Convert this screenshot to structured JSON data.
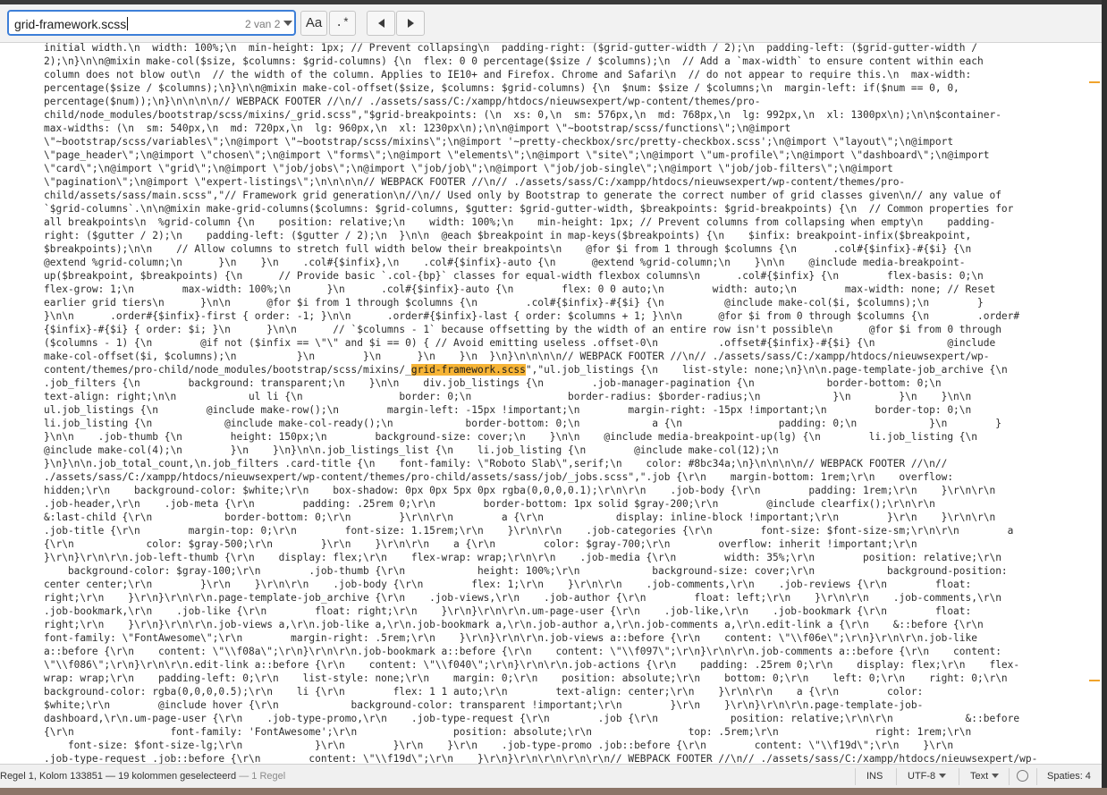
{
  "find": {
    "query": "grid-framework.scss",
    "match_count": "2 van 2",
    "case_label": "Aa",
    "regex_label": ".*"
  },
  "editor": {
    "lines": [
      "initial width.\\n  width: 100%;\\n  min-height: 1px; // Prevent collapsing\\n  padding-right: ($grid-gutter-width / 2);\\n  padding-left: ($grid-gutter-width /",
      "2);\\n}\\n\\n@mixin make-col($size, $columns: $grid-columns) {\\n  flex: 0 0 percentage($size / $columns);\\n  // Add a `max-width` to ensure content within each",
      "column does not blow out\\n  // the width of the column. Applies to IE10+ and Firefox. Chrome and Safari\\n  // do not appear to require this.\\n  max-width:",
      "percentage($size / $columns);\\n}\\n\\n@mixin make-col-offset($size, $columns: $grid-columns) {\\n  $num: $size / $columns;\\n  margin-left: if($num == 0, 0,",
      "percentage($num));\\n}\\n\\n\\n\\n// WEBPACK FOOTER //\\n// ./assets/sass/C:/xampp/htdocs/nieuwsexpert/wp-content/themes/pro-",
      "child/node_modules/bootstrap/scss/mixins/_grid.scss\",\"$grid-breakpoints: (\\n  xs: 0,\\n  sm: 576px,\\n  md: 768px,\\n  lg: 992px,\\n  xl: 1300px\\n);\\n\\n$container-",
      "max-widths: (\\n  sm: 540px,\\n  md: 720px,\\n  lg: 960px,\\n  xl: 1230px\\n);\\n\\n@import \\\"~bootstrap/scss/functions\\\";\\n@import",
      "\\\"~bootstrap/scss/variables\\\";\\n@import \\\"~bootstrap/scss/mixins\\\";\\n@import '~pretty-checkbox/src/pretty-checkbox.scss';\\n@import \\\"layout\\\";\\n@import",
      "\\\"page_header\\\";\\n@import \\\"chosen\\\";\\n@import \\\"forms\\\";\\n@import \\\"elements\\\";\\n@import \\\"site\\\";\\n@import \\\"um-profile\\\";\\n@import \\\"dashboard\\\";\\n@import",
      "\\\"card\\\";\\n@import \\\"grid\\\";\\n@import \\\"job/jobs\\\";\\n@import \\\"job/job\\\";\\n@import \\\"job/job-single\\\";\\n@import \\\"job/job-filters\\\";\\n@import",
      "\\\"pagination\\\";\\n@import \\\"expert-listings\\\";\\n\\n\\n\\n// WEBPACK FOOTER //\\n// ./assets/sass/C:/xampp/htdocs/nieuwsexpert/wp-content/themes/pro-",
      "child/assets/sass/main.scss\",\"// Framework grid generation\\n//\\n// Used only by Bootstrap to generate the correct number of grid classes given\\n// any value of",
      "`$grid-columns`.\\n\\n@mixin make-grid-columns($columns: $grid-columns, $gutter: $grid-gutter-width, $breakpoints: $grid-breakpoints) {\\n  // Common properties for",
      "all breakpoints\\n  %grid-column {\\n    position: relative;\\n    width: 100%;\\n    min-height: 1px; // Prevent columns from collapsing when empty\\n    padding-",
      "right: ($gutter / 2);\\n    padding-left: ($gutter / 2);\\n  }\\n\\n  @each $breakpoint in map-keys($breakpoints) {\\n    $infix: breakpoint-infix($breakpoint,",
      "$breakpoints);\\n\\n    // Allow columns to stretch full width below their breakpoints\\n    @for $i from 1 through $columns {\\n      .col#{$infix}-#{$i} {\\n",
      "@extend %grid-column;\\n      }\\n    }\\n    .col#{$infix},\\n    .col#{$infix}-auto {\\n      @extend %grid-column;\\n    }\\n\\n    @include media-breakpoint-",
      "up($breakpoint, $breakpoints) {\\n      // Provide basic `.col-{bp}` classes for equal-width flexbox columns\\n      .col#{$infix} {\\n        flex-basis: 0;\\n",
      "flex-grow: 1;\\n        max-width: 100%;\\n      }\\n      .col#{$infix}-auto {\\n        flex: 0 0 auto;\\n        width: auto;\\n        max-width: none; // Reset",
      "earlier grid tiers\\n      }\\n\\n      @for $i from 1 through $columns {\\n        .col#{$infix}-#{$i} {\\n          @include make-col($i, $columns);\\n        }",
      "}\\n\\n      .order#{$infix}-first { order: -1; }\\n\\n      .order#{$infix}-last { order: $columns + 1; }\\n\\n      @for $i from 0 through $columns {\\n        .order#",
      "{$infix}-#{$i} { order: $i; }\\n      }\\n\\n      // `$columns - 1` because offsetting by the width of an entire row isn't possible\\n      @for $i from 0 through",
      "($columns - 1) {\\n        @if not ($infix == \\\"\\\" and $i == 0) { // Avoid emitting useless .offset-0\\n          .offset#{$infix}-#{$i} {\\n            @include",
      "make-col-offset($i, $columns);\\n          }\\n        }\\n      }\\n    }\\n  }\\n}\\n\\n\\n\\n// WEBPACK FOOTER //\\n// ./assets/sass/C:/xampp/htdocs/nieuwsexpert/wp-",
      "content/themes/pro-child/node_modules/bootstrap/scss/mixins/_grid-framework.scss\",\"ul.job_listings {\\n    list-style: none;\\n}\\n\\n.page-template-job_archive {\\n",
      ".job_filters {\\n        background: transparent;\\n    }\\n\\n    div.job_listings {\\n        .job-manager-pagination {\\n            border-bottom: 0;\\n",
      "text-align: right;\\n\\n            ul li {\\n                border: 0;\\n                border-radius: $border-radius;\\n            }\\n        }\\n    }\\n\\n",
      "ul.job_listings {\\n        @include make-row();\\n        margin-left: -15px !important;\\n        margin-right: -15px !important;\\n        border-top: 0;\\n",
      "li.job_listing {\\n            @include make-col-ready();\\n            border-bottom: 0;\\n            a {\\n                padding: 0;\\n            }\\n        }",
      "}\\n\\n    .job-thumb {\\n        height: 150px;\\n        background-size: cover;\\n    }\\n\\n    @include media-breakpoint-up(lg) {\\n        li.job_listing {\\n",
      "@include make-col(4);\\n        }\\n    }\\n}\\n\\n.job_listings_list {\\n    li.job_listing {\\n        @include make-col(12);\\n",
      "}\\n}\\n\\n.job_total_count,\\n.job_filters .card-title {\\n    font-family: \\\"Roboto Slab\\\",serif;\\n    color: #8bc34a;\\n}\\n\\n\\n\\n// WEBPACK FOOTER //\\n//",
      "./assets/sass/C:/xampp/htdocs/nieuwsexpert/wp-content/themes/pro-child/assets/sass/job/_jobs.scss\",\".job {\\r\\n    margin-bottom: 1rem;\\r\\n    overflow:",
      "hidden;\\r\\n    background-color: $white;\\r\\n    box-shadow: 0px 0px 5px 0px rgba(0,0,0,0.1);\\r\\n\\r\\n    .job-body {\\r\\n        padding: 1rem;\\r\\n    }\\r\\n\\r\\n",
      ".job-header,\\r\\n    .job-meta {\\r\\n        padding: .25rem 0;\\r\\n        border-bottom: 1px solid $gray-200;\\r\\n        @include clearfix();\\r\\n\\r\\n",
      "&:last-child {\\r\\n            border-bottom: 0;\\r\\n        }\\r\\n\\r\\n        a {\\r\\n            display: inline-block !important;\\r\\n        }\\r\\n    }\\r\\n\\r\\n",
      ".job-title {\\r\\n        margin-top: 0;\\r\\n        font-size: 1.15rem;\\r\\n    }\\r\\n\\r\\n    .job-categories {\\r\\n        font-size: $font-size-sm;\\r\\n\\r\\n        a",
      "{\\r\\n            color: $gray-500;\\r\\n        }\\r\\n    }\\r\\n\\r\\n    a {\\r\\n        color: $gray-700;\\r\\n        overflow: inherit !important;\\r\\n",
      "}\\r\\n}\\r\\n\\r\\n.job-left-thumb {\\r\\n    display: flex;\\r\\n    flex-wrap: wrap;\\r\\n\\r\\n    .job-media {\\r\\n        width: 35%;\\r\\n        position: relative;\\r\\n",
      "    background-color: $gray-100;\\r\\n        .job-thumb {\\r\\n            height: 100%;\\r\\n            background-size: cover;\\r\\n            background-position:",
      "center center;\\r\\n        }\\r\\n    }\\r\\n\\r\\n    .job-body {\\r\\n        flex: 1;\\r\\n    }\\r\\n\\r\\n    .job-comments,\\r\\n    .job-reviews {\\r\\n        float:",
      "right;\\r\\n    }\\r\\n}\\r\\n\\r\\n.page-template-job_archive {\\r\\n    .job-views,\\r\\n    .job-author {\\r\\n        float: left;\\r\\n    }\\r\\n\\r\\n    .job-comments,\\r\\n",
      ".job-bookmark,\\r\\n    .job-like {\\r\\n        float: right;\\r\\n    }\\r\\n}\\r\\n\\r\\n.um-page-user {\\r\\n    .job-like,\\r\\n    .job-bookmark {\\r\\n        float:",
      "right;\\r\\n    }\\r\\n}\\r\\n\\r\\n.job-views a,\\r\\n.job-like a,\\r\\n.job-bookmark a,\\r\\n.job-author a,\\r\\n.job-comments a,\\r\\n.edit-link a {\\r\\n    &::before {\\r\\n",
      "font-family: \\\"FontAwesome\\\";\\r\\n        margin-right: .5rem;\\r\\n    }\\r\\n}\\r\\n\\r\\n.job-views a::before {\\r\\n    content: \\\"\\\\f06e\\\";\\r\\n}\\r\\n\\r\\n.job-like",
      "a::before {\\r\\n    content: \\\"\\\\f08a\\\";\\r\\n}\\r\\n\\r\\n.job-bookmark a::before {\\r\\n    content: \\\"\\\\f097\\\";\\r\\n}\\r\\n\\r\\n.job-comments a::before {\\r\\n    content:",
      "\\\"\\\\f086\\\";\\r\\n}\\r\\n\\r\\n.edit-link a::before {\\r\\n    content: \\\"\\\\f040\\\";\\r\\n}\\r\\n\\r\\n.job-actions {\\r\\n    padding: .25rem 0;\\r\\n    display: flex;\\r\\n    flex-",
      "wrap: wrap;\\r\\n    padding-left: 0;\\r\\n    list-style: none;\\r\\n    margin: 0;\\r\\n    position: absolute;\\r\\n    bottom: 0;\\r\\n    left: 0;\\r\\n    right: 0;\\r\\n",
      "background-color: rgba(0,0,0,0.5);\\r\\n    li {\\r\\n        flex: 1 1 auto;\\r\\n        text-align: center;\\r\\n    }\\r\\n\\r\\n    a {\\r\\n        color:",
      "$white;\\r\\n        @include hover {\\r\\n            background-color: transparent !important;\\r\\n        }\\r\\n    }\\r\\n}\\r\\n\\r\\n.page-template-job-",
      "dashboard,\\r\\n.um-page-user {\\r\\n    .job-type-promo,\\r\\n    .job-type-request {\\r\\n        .job {\\r\\n            position: relative;\\r\\n\\r\\n            &::before",
      "{\\r\\n                font-family: 'FontAwesome';\\r\\n                position: absolute;\\r\\n                top: .5rem;\\r\\n                right: 1rem;\\r\\n",
      "    font-size: $font-size-lg;\\r\\n            }\\r\\n        }\\r\\n    }\\r\\n    .job-type-promo .job::before {\\r\\n        content: \\\"\\\\f19d\\\";\\r\\n    }\\r\\n",
      ".job-type-request .job::before {\\r\\n        content: \\\"\\\\f19d\\\";\\r\\n    }\\r\\n}\\r\\n\\r\\n\\r\\n\\r\\n// WEBPACK FOOTER //\\n// ./assets/sass/C:/xampp/htdocs/nieuwsexpert/wp-"
    ],
    "highlight_line": 24,
    "highlight_text": "grid-framework.scss"
  },
  "status": {
    "position": "Regel 1, Kolom 133851 — 19 kolommen geselecteerd",
    "position_extra": "— 1 Regel",
    "mode": "INS",
    "encoding": "UTF-8",
    "language": "Text",
    "indent": "Spaties: 4"
  },
  "colors": {
    "accent": "#3d7fd8",
    "match_highlight": "#f6b436",
    "scroll_marker": "#f0a32b"
  }
}
